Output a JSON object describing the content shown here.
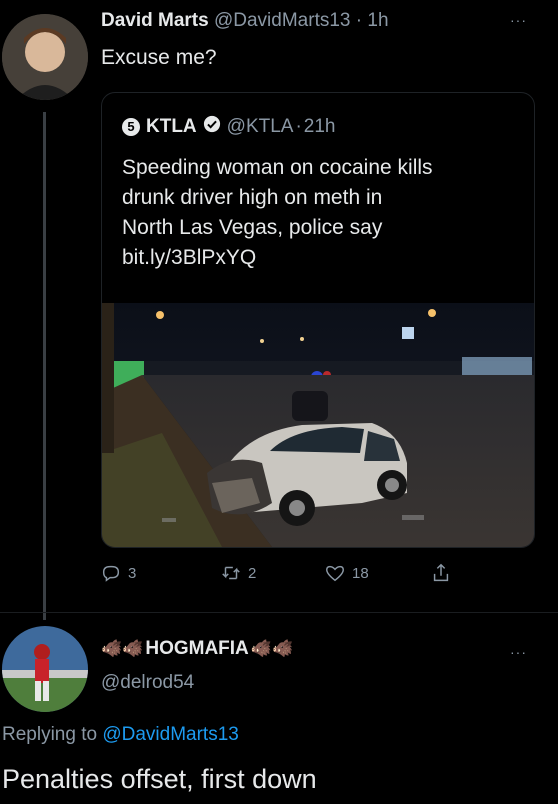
{
  "tweet": {
    "author_name": "David Marts",
    "author_handle": "@DavidMarts13",
    "separator": "·",
    "time": "1h",
    "more": "···",
    "text": "Excuse me?"
  },
  "quote": {
    "badge": "5",
    "author_name": "KTLA",
    "author_handle": "@KTLA",
    "separator": "·",
    "time": "21h",
    "line1": "Speeding woman on cocaine kills",
    "line2": "drunk driver high on meth in",
    "line3": "North Las Vegas, police say",
    "line4": "bit.ly/3BlPxYQ"
  },
  "actions": {
    "reply_count": "3",
    "retweet_count": "2",
    "like_count": "18"
  },
  "reply": {
    "author_name": "HOGMAFIA",
    "author_handle": "@delrod54",
    "more": "···",
    "replying_prefix": "Replying to",
    "replying_to": "@DavidMarts13",
    "text": "Penalties offset, first down"
  },
  "colors": {
    "background": "#000000",
    "text": "#e7e9ea",
    "muted": "#8b98a5",
    "link": "#1d9bf0",
    "verified": "#e7e9ea"
  }
}
